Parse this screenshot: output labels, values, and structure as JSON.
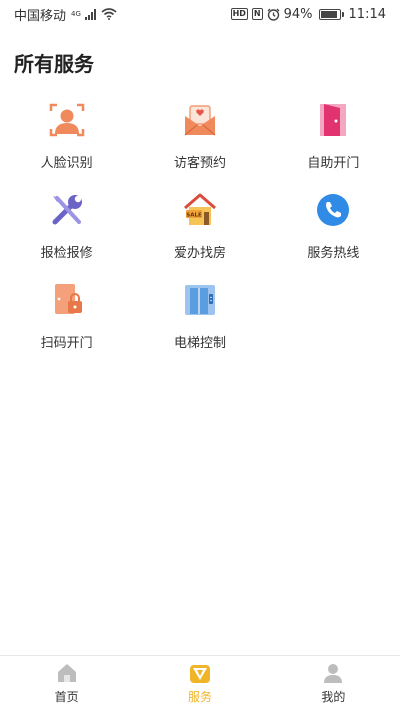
{
  "status_bar": {
    "carrier": "中国移动",
    "network": "4G",
    "hd": "HD",
    "nfc": "N",
    "battery": "94%",
    "battery_level": 0.94,
    "time": "11:14"
  },
  "page": {
    "title": "所有服务"
  },
  "services": [
    {
      "label": "人脸识别",
      "icon": "face-recognition-icon"
    },
    {
      "label": "访客预约",
      "icon": "visitor-envelope-icon"
    },
    {
      "label": "自助开门",
      "icon": "door-icon"
    },
    {
      "label": "报检报修",
      "icon": "tools-icon"
    },
    {
      "label": "爱办找房",
      "icon": "house-sale-icon"
    },
    {
      "label": "服务热线",
      "icon": "phone-icon"
    },
    {
      "label": "扫码开门",
      "icon": "door-lock-icon"
    },
    {
      "label": "电梯控制",
      "icon": "elevator-icon"
    }
  ],
  "tabbar": {
    "items": [
      {
        "label": "首页",
        "icon": "home-icon"
      },
      {
        "label": "服务",
        "icon": "service-icon"
      },
      {
        "label": "我的",
        "icon": "profile-icon"
      }
    ],
    "active_color": "#f0b428"
  },
  "colors": {
    "accent_orange": "#f08a5d",
    "accent_pink": "#e0336f",
    "accent_purple": "#6c63c7",
    "accent_blue": "#2f8be6"
  }
}
